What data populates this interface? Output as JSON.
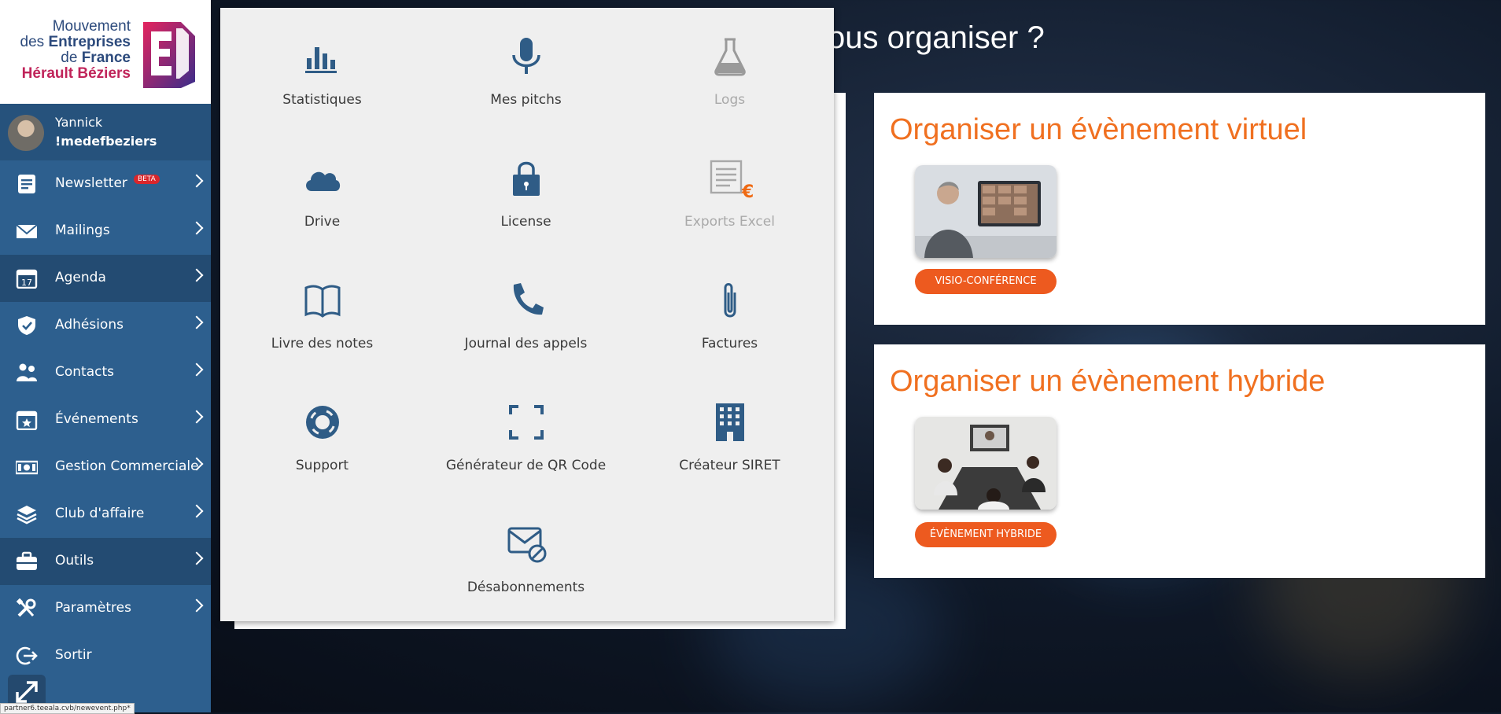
{
  "logo": {
    "line1": "Mouvement",
    "line2a": "des ",
    "line2b": "Entreprises",
    "line3a": "de ",
    "line3b": "France",
    "line4": "Hérault Béziers",
    "colors": {
      "navy": "#2c4a7c",
      "magenta": "#c0245a"
    }
  },
  "user": {
    "first_name": "Yannick",
    "org": "!medefbeziers"
  },
  "menu": [
    {
      "label": "Newsletter",
      "icon": "newsletter-icon",
      "badge": "BETA"
    },
    {
      "label": "Mailings",
      "icon": "envelope-icon"
    },
    {
      "label": "Agenda",
      "icon": "calendar-icon",
      "active": true
    },
    {
      "label": "Adhésions",
      "icon": "shield-check-icon"
    },
    {
      "label": "Contacts",
      "icon": "users-icon"
    },
    {
      "label": "Événements",
      "icon": "calendar-star-icon"
    },
    {
      "label": "Gestion Commerciale",
      "icon": "money-icon"
    },
    {
      "label": "Club d'affaire",
      "icon": "layers-icon"
    },
    {
      "label": "Outils",
      "icon": "briefcase-icon",
      "active": true
    },
    {
      "label": "Paramètres",
      "icon": "tools-icon"
    },
    {
      "label": "Sortir",
      "icon": "logout-icon"
    }
  ],
  "status_url": "partner6.teeala.cvb/newevent.php*",
  "heading": "ous organiser ?",
  "cards": [
    {
      "title": "Organiser un évènement virtuel",
      "button": "VISIO-CONFÉRENCE"
    },
    {
      "title": "Organiser un évènement hybride",
      "button": "ÉVÈNEMENT HYBRIDE"
    }
  ],
  "tools": [
    {
      "label": "Statistiques",
      "icon": "bar-chart-icon"
    },
    {
      "label": "Mes pitchs",
      "icon": "microphone-icon"
    },
    {
      "label": "Logs",
      "icon": "flask-icon",
      "disabled": true
    },
    {
      "label": "Drive",
      "icon": "cloud-icon"
    },
    {
      "label": "License",
      "icon": "lock-icon"
    },
    {
      "label": "Exports Excel",
      "icon": "document-euro-icon",
      "disabled": true,
      "symbol": "€"
    },
    {
      "label": "Livre des notes",
      "icon": "book-icon"
    },
    {
      "label": "Journal des appels",
      "icon": "phone-icon"
    },
    {
      "label": "Factures",
      "icon": "paperclip-icon"
    },
    {
      "label": "Support",
      "icon": "lifebuoy-icon"
    },
    {
      "label": "Générateur de QR Code",
      "icon": "qr-frame-icon"
    },
    {
      "label": "Créateur SIRET",
      "icon": "building-icon"
    },
    {
      "label": "Désabonnements",
      "icon": "unsubscribe-icon"
    }
  ],
  "colors": {
    "sidebar": "#2d5f8e",
    "accent": "#ed5a1f",
    "title": "#f07020",
    "tool_icon": "#2f5c86"
  }
}
